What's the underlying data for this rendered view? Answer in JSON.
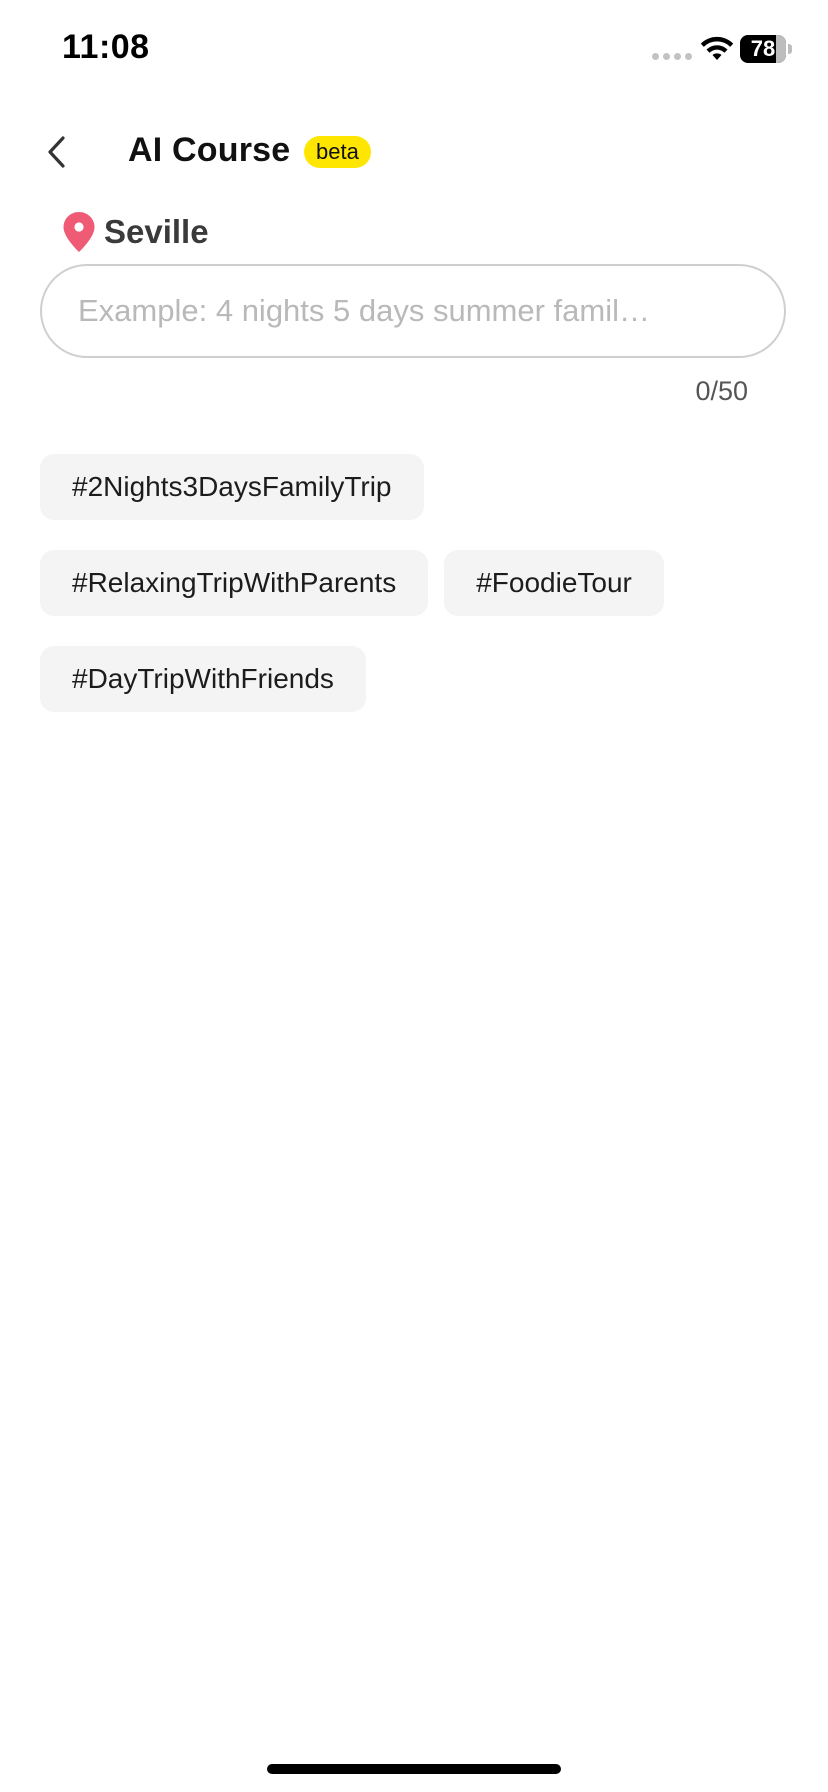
{
  "status_bar": {
    "time": "11:08",
    "battery_level": "78",
    "battery_fraction": 0.78
  },
  "header": {
    "title": "AI Course",
    "badge": "beta",
    "back_icon": "chevron-left-icon"
  },
  "location": {
    "icon": "map-pin-icon",
    "name": "Seville"
  },
  "input": {
    "placeholder": "Example: 4 nights 5 days summer famil…",
    "value": "",
    "counter": "0/50"
  },
  "tags": [
    {
      "label": "#2Nights3DaysFamilyTrip"
    },
    {
      "label": "#RelaxingTripWithParents"
    },
    {
      "label": "#FoodieTour"
    },
    {
      "label": "#DayTripWithFriends"
    }
  ],
  "colors": {
    "badge_background": "#ffe600",
    "pin": "#ef5a75",
    "chip_background": "#f4f4f4",
    "input_border": "#cfcfcf"
  }
}
